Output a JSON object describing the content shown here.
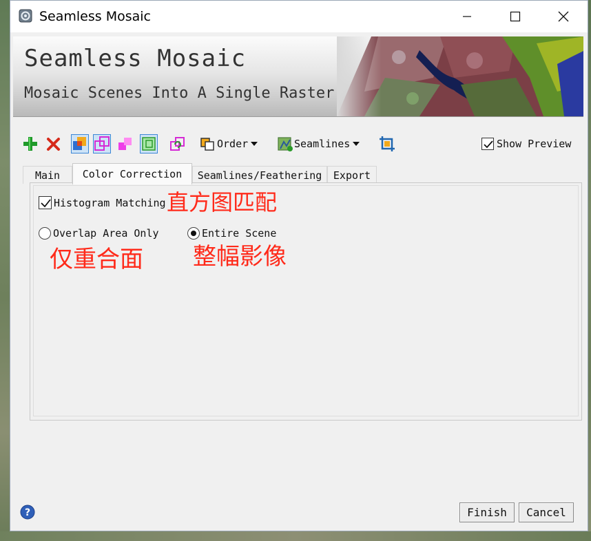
{
  "window": {
    "title": "Seamless Mosaic"
  },
  "banner": {
    "title": "Seamless Mosaic",
    "subtitle": "Mosaic Scenes Into A Single Raster"
  },
  "toolbar": {
    "order_label": "Order",
    "seamlines_label": "Seamlines",
    "show_preview_label": "Show Preview",
    "show_preview_checked": true
  },
  "tabs": [
    {
      "label": "Main",
      "active": false
    },
    {
      "label": "Color Correction",
      "active": true
    },
    {
      "label": "Seamlines/Feathering",
      "active": false
    },
    {
      "label": "Export",
      "active": false
    }
  ],
  "color_correction": {
    "histogram_label": "Histogram Matching",
    "histogram_checked": true,
    "histogram_annotation": "直方图匹配",
    "overlap_label": "Overlap Area Only",
    "overlap_annotation": "仅重合面",
    "entire_label": "Entire Scene",
    "entire_annotation": "整幅影像",
    "selected_option": "Entire Scene"
  },
  "buttons": {
    "finish": "Finish",
    "cancel": "Cancel"
  },
  "colors": {
    "annotation_red": "#ff2a1a",
    "window_bg": "#f0f0f0",
    "help_blue": "#2f5fb8"
  },
  "icons": [
    "app-icon",
    "minimize-icon",
    "maximize-icon",
    "close-icon",
    "add-icon",
    "delete-icon",
    "footprint-icon",
    "seamline-edit-icon",
    "color-icon",
    "reference-icon",
    "refresh-icon",
    "order-icon",
    "seamlines-icon",
    "crop-icon",
    "help-icon"
  ]
}
